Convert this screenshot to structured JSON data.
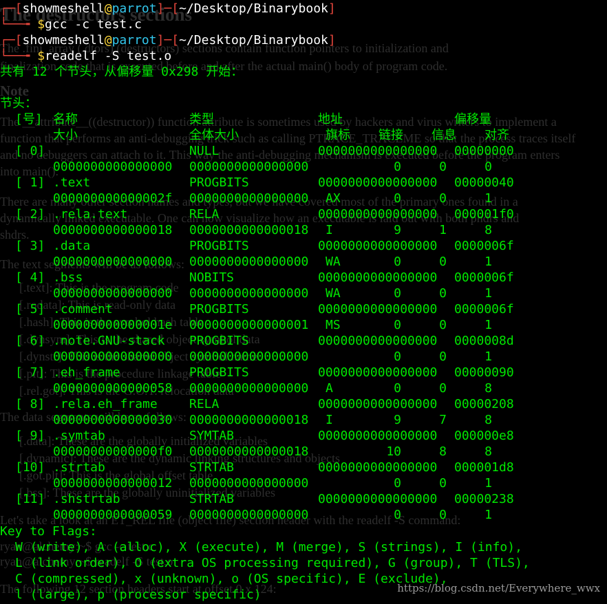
{
  "prompts": [
    {
      "user": "showmeshell",
      "at": "@",
      "host": "parrot",
      "path": "~/Desktop/Binarybook",
      "command": "gcc -c test.c"
    },
    {
      "user": "showmeshell",
      "at": "@",
      "host": "parrot",
      "path": "~/Desktop/Binarybook",
      "command": "readelf -S test.o"
    }
  ],
  "output": {
    "summary": "共有 12 个节头，从偏移量 0x298 开始：",
    "section_title": "节头：",
    "headers": {
      "row1": {
        "num": "[号]",
        "name": "名称",
        "type": "类型",
        "address": "地址",
        "offset": "偏移量"
      },
      "row2": {
        "size": "大小",
        "entsize": "全体大小",
        "flags": "旗标",
        "link": "链接",
        "info": "信息",
        "align": "对齐"
      }
    },
    "sections": [
      {
        "num": "[ 0]",
        "name": "",
        "type": "NULL",
        "address": "0000000000000000",
        "offset": "00000000",
        "size": "0000000000000000",
        "entsize": "0000000000000000",
        "flags": "",
        "link": "0",
        "info": "0",
        "align": "0"
      },
      {
        "num": "[ 1]",
        "name": ".text",
        "type": "PROGBITS",
        "address": "0000000000000000",
        "offset": "00000040",
        "size": "000000000000002f",
        "entsize": "0000000000000000",
        "flags": "AX",
        "link": "0",
        "info": "0",
        "align": "1"
      },
      {
        "num": "[ 2]",
        "name": ".rela.text",
        "type": "RELA",
        "address": "0000000000000000",
        "offset": "000001f0",
        "size": "0000000000000018",
        "entsize": "0000000000000018",
        "flags": "I",
        "link": "9",
        "info": "1",
        "align": "8"
      },
      {
        "num": "[ 3]",
        "name": ".data",
        "type": "PROGBITS",
        "address": "0000000000000000",
        "offset": "0000006f",
        "size": "0000000000000000",
        "entsize": "0000000000000000",
        "flags": "WA",
        "link": "0",
        "info": "0",
        "align": "1"
      },
      {
        "num": "[ 4]",
        "name": ".bss",
        "type": "NOBITS",
        "address": "0000000000000000",
        "offset": "0000006f",
        "size": "0000000000000000",
        "entsize": "0000000000000000",
        "flags": "WA",
        "link": "0",
        "info": "0",
        "align": "1"
      },
      {
        "num": "[ 5]",
        "name": ".comment",
        "type": "PROGBITS",
        "address": "0000000000000000",
        "offset": "0000006f",
        "size": "000000000000001e",
        "entsize": "0000000000000001",
        "flags": "MS",
        "link": "0",
        "info": "0",
        "align": "1"
      },
      {
        "num": "[ 6]",
        "name": ".note.GNU-stack",
        "type": "PROGBITS",
        "address": "0000000000000000",
        "offset": "0000008d",
        "size": "0000000000000000",
        "entsize": "0000000000000000",
        "flags": "",
        "link": "0",
        "info": "0",
        "align": "1"
      },
      {
        "num": "[ 7]",
        "name": ".eh_frame",
        "type": "PROGBITS",
        "address": "0000000000000000",
        "offset": "00000090",
        "size": "0000000000000058",
        "entsize": "0000000000000000",
        "flags": "A",
        "link": "0",
        "info": "0",
        "align": "8"
      },
      {
        "num": "[ 8]",
        "name": ".rela.eh_frame",
        "type": "RELA",
        "address": "0000000000000000",
        "offset": "00000208",
        "size": "0000000000000030",
        "entsize": "0000000000000018",
        "flags": "I",
        "link": "9",
        "info": "7",
        "align": "8"
      },
      {
        "num": "[ 9]",
        "name": ".symtab",
        "type": "SYMTAB",
        "address": "0000000000000000",
        "offset": "000000e8",
        "size": "00000000000000f0",
        "entsize": "0000000000000018",
        "flags": "",
        "link": "10",
        "info": "8",
        "align": "8"
      },
      {
        "num": "[10]",
        "name": ".strtab",
        "type": "STRTAB",
        "address": "0000000000000000",
        "offset": "000001d8",
        "size": "0000000000000012",
        "entsize": "0000000000000000",
        "flags": "",
        "link": "0",
        "info": "0",
        "align": "1"
      },
      {
        "num": "[11]",
        "name": ".shstrtab",
        "type": "STRTAB",
        "address": "0000000000000000",
        "offset": "00000238",
        "size": "0000000000000059",
        "entsize": "0000000000000000",
        "flags": "",
        "link": "0",
        "info": "0",
        "align": "1"
      }
    ],
    "key_to_flags": {
      "title": "Key to Flags:",
      "lines": [
        "W (write), A (alloc), X (execute), M (merge), S (strings), I (info),",
        "L (link order), O (extra OS processing required), G (group), T (TLS),",
        "C (compressed), x (unknown), o (OS specific), E (exclude),",
        "l (large), p (processor specific)"
      ]
    }
  },
  "background_page": {
    "lines": [
      "The destructors sections",
      "The .fini_array (.dtors) (destructors) sections contain function pointers to initialization and",
      "finalization code that is executed before and after the actual main() body of program code.",
      "Note",
      "The __attribute__((destructor)) function attribute is sometimes used by hackers and virus writers to implement a",
      "function that performs an anti-debugging trick such as calling PTRACE_TRACEME so that the process traces itself",
      "and no debuggers can attach to it. This way the anti-debugging mechanism is executed before the program enters",
      "into main().",
      "There are many other section names and types, but we have covered most of the primary ones found in a",
      "dynamically linked executable. One can now visualize how an executable is laid out with both phdrs and",
      "shdrs.",
      "The text segments will be as follows:",
      "[.text]: This is the program code",
      "[.rodata]: This is read-only data",
      "[.hash]: This is the symbol hash table",
      "[.dynsym]: This is the shared object symbol data",
      "[.dynstr]: This is the shared object symbol name",
      "[.plt]: This is the procedure linkage table",
      "[.rel.got]: This is the G.O.T. relocation data",
      "The data segments will be as follows:",
      "[.data]: These are the globally initialized variables",
      "[.dynamic]: These are the dynamic linking structures and objects",
      "[.got.plt]: This is the global offset table",
      "[.bss]: These are the globally uninitialized variables",
      "Let's take a look at an ET_REL file (object file) section header with the readelf -S command:",
      "ryan@alchemy:~$ gcc -c test.c",
      "ryan@alchemy:~$ readelf -S test.o",
      "The following 12 section headers start at offset 0 x 124:"
    ]
  },
  "watermark": "https://blog.csdn.net/Everywhere_wwx"
}
